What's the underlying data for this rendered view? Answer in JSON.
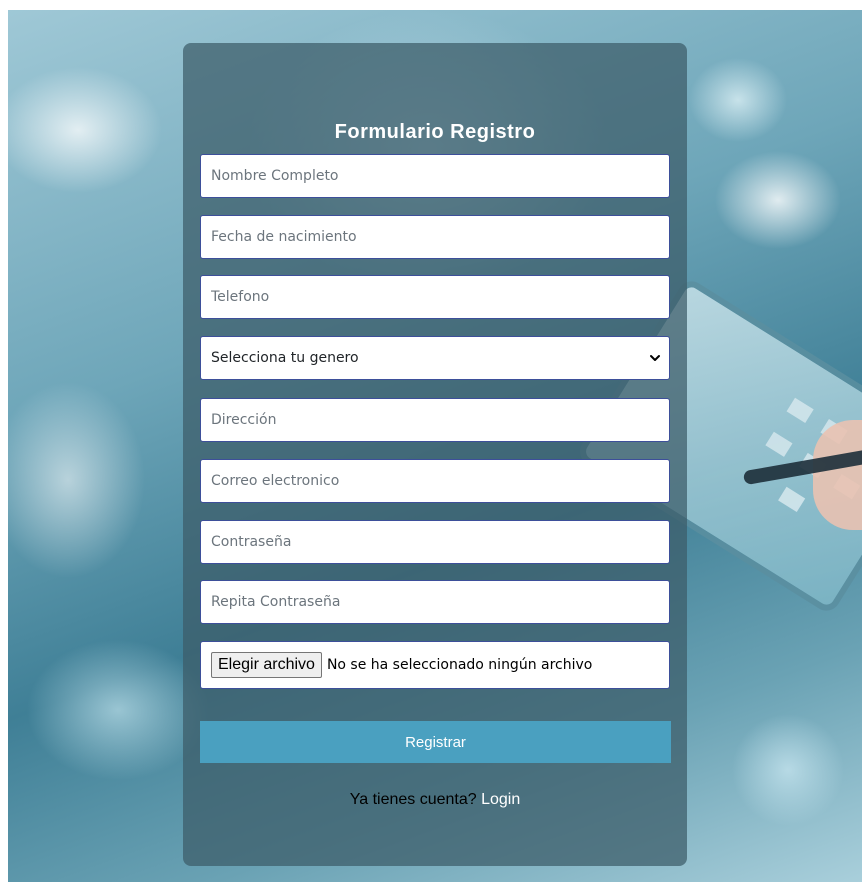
{
  "form": {
    "title": "Formulario Registro",
    "fields": {
      "nombre": "Nombre Completo",
      "fecha": "Fecha de nacimiento",
      "telefono": "Telefono",
      "direccion": "Dirección",
      "correo": "Correo electronico",
      "contrasena": "Contraseña",
      "repita": "Repita Contraseña"
    },
    "genero_select": {
      "selected": "Selecciona tu genero"
    },
    "file": {
      "button_label": "Elegir archivo",
      "status": "No se ha seleccionado ningún archivo"
    },
    "submit_label": "Registrar",
    "account_prompt": "Ya tienes cuenta?",
    "login_link": "Login"
  },
  "icons": {
    "select_arrow": "chevron-down-icon"
  },
  "colors": {
    "card_bg": "#3c5c68",
    "submit_bg": "#4aa0c0",
    "field_border": "#3d4f9a",
    "link": "#ffffff"
  }
}
